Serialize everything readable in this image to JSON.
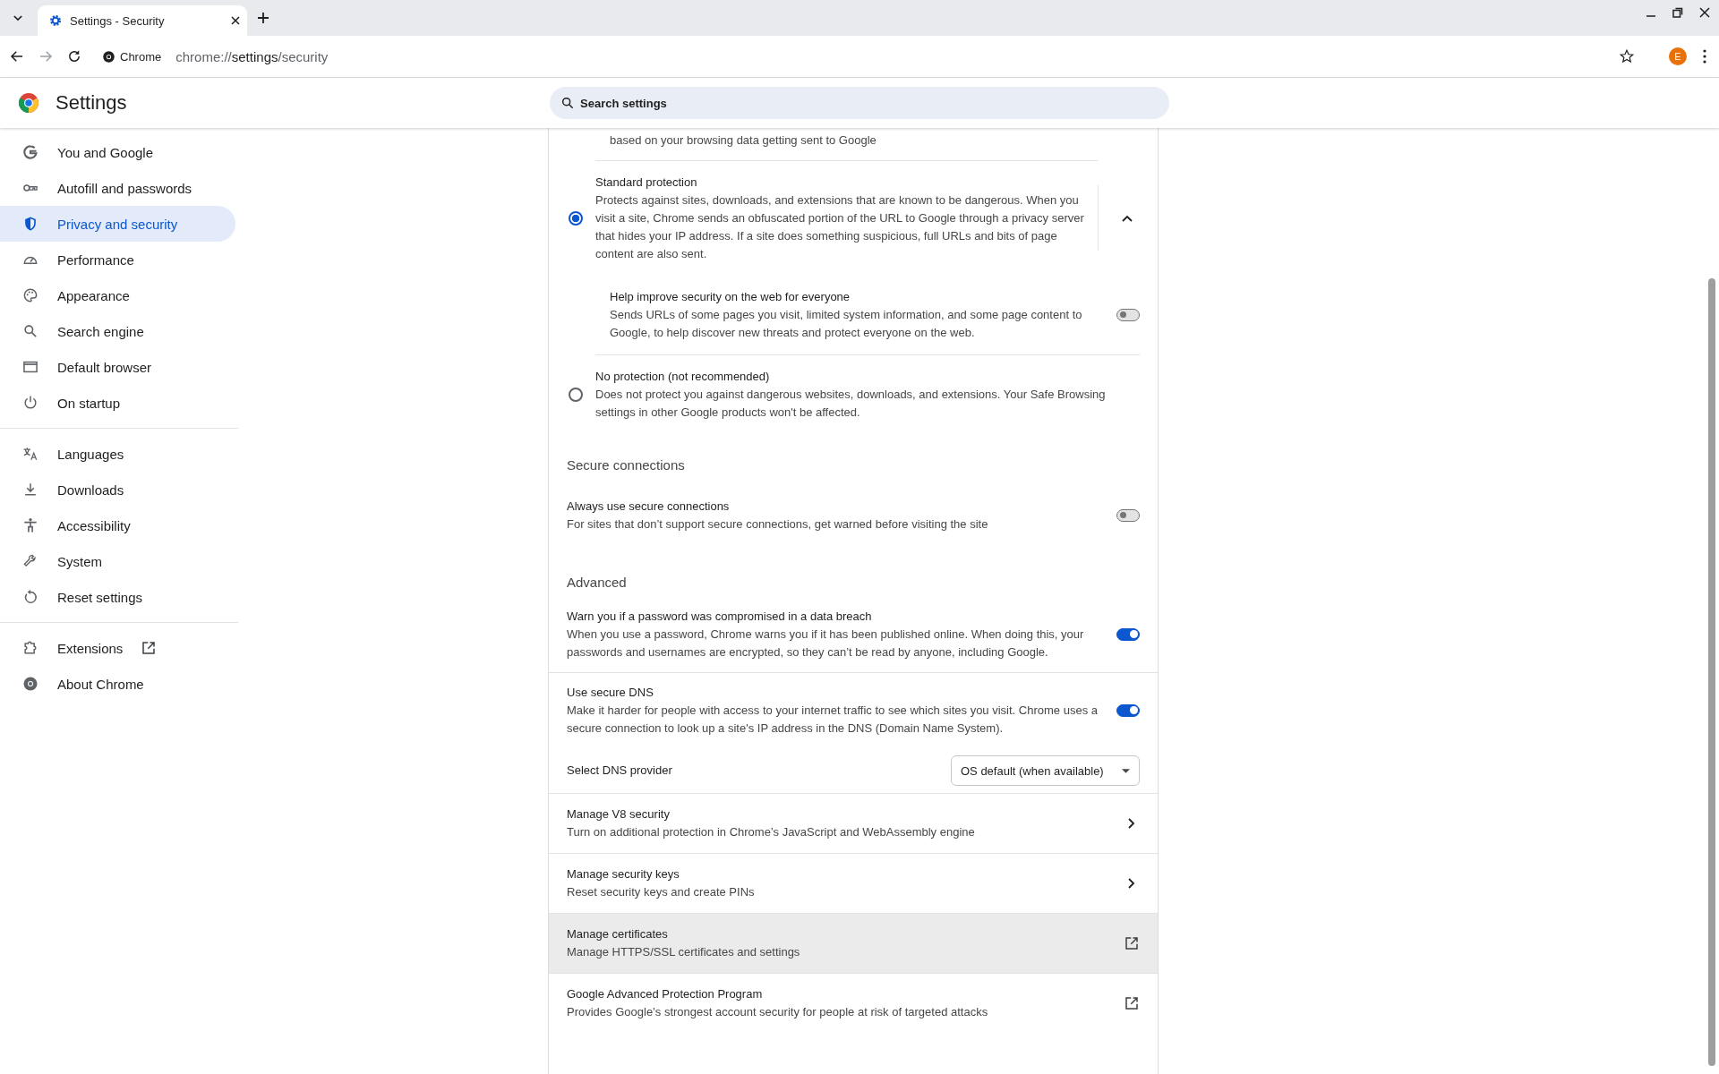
{
  "browser": {
    "tabs": [
      {
        "title": "Settings - Security",
        "selected": true
      }
    ],
    "site_chip": "Chrome",
    "url_prefix": "chrome://",
    "url_path": "settings/security",
    "avatar": "E"
  },
  "header": {
    "title": "Settings",
    "search": {
      "placeholder": "Search settings"
    }
  },
  "sidebar": {
    "groups": [
      {
        "items": [
          {
            "label": "You and Google",
            "kind": "page",
            "selected": false
          },
          {
            "label": "Autofill and passwords",
            "kind": "page",
            "selected": false
          },
          {
            "label": "Privacy and security",
            "kind": "page",
            "selected": true
          },
          {
            "label": "Performance",
            "kind": "page",
            "selected": false
          },
          {
            "label": "Appearance",
            "kind": "page",
            "selected": false
          },
          {
            "label": "Search engine",
            "kind": "page",
            "selected": false
          },
          {
            "label": "Default browser",
            "kind": "page",
            "selected": false
          },
          {
            "label": "On startup",
            "kind": "page",
            "selected": false
          }
        ]
      },
      {
        "items": [
          {
            "label": "Languages",
            "kind": "page",
            "selected": false
          },
          {
            "label": "Downloads",
            "kind": "page",
            "selected": false
          },
          {
            "label": "Accessibility",
            "kind": "page",
            "selected": false
          },
          {
            "label": "System",
            "kind": "page",
            "selected": false
          },
          {
            "label": "Reset settings",
            "kind": "page",
            "selected": false
          }
        ]
      },
      {
        "items": [
          {
            "label": "Extensions",
            "kind": "external",
            "selected": false
          },
          {
            "label": "About Chrome",
            "kind": "page",
            "selected": false
          }
        ]
      }
    ]
  },
  "content": {
    "blocks": [
      {
        "kind": "cut_text",
        "description": "based on your browsing data getting sent to Google"
      },
      {
        "kind": "radio",
        "title": "Standard protection",
        "description": "Protects against sites, downloads, and extensions that are known to be dangerous. When you visit a site, Chrome sends an obfuscated portion of the URL to Google through a privacy server that hides your IP address. If a site does something suspicious, full URLs and bits of page content are also sent.",
        "selected": true,
        "expanded": true
      },
      {
        "kind": "subtoggle",
        "title": "Help improve security on the web for everyone",
        "description": "Sends URLs of some pages you visit, limited system information, and some page content to Google, to help discover new threats and protect everyone on the web.",
        "on": false
      },
      {
        "kind": "radio",
        "title": "No protection (not recommended)",
        "description": "Does not protect you against dangerous websites, downloads, and extensions. Your Safe Browsing settings in other Google products won't be affected.",
        "selected": false
      },
      {
        "kind": "heading",
        "title": "Secure connections"
      },
      {
        "kind": "toggle",
        "title": "Always use secure connections",
        "description": "For sites that don’t support secure connections, get warned before visiting the site",
        "on": false
      },
      {
        "kind": "heading",
        "title": "Advanced"
      },
      {
        "kind": "toggle",
        "title": "Warn you if a password was compromised in a data breach",
        "description": "When you use a password, Chrome warns you if it has been published online. When doing this, your passwords and usernames are encrypted, so they can’t be read by anyone, including Google.",
        "on": true
      },
      {
        "kind": "toggle",
        "title": "Use secure DNS",
        "description": "Make it harder for people with access to your internet traffic to see which sites you visit. Chrome uses a secure connection to look up a site's IP address in the DNS (Domain Name System).",
        "on": true
      },
      {
        "kind": "select",
        "title": "Select DNS provider",
        "value": "OS default (when available)"
      },
      {
        "kind": "subpage_link",
        "title": "Manage V8 security",
        "description": "Turn on additional protection in Chrome’s JavaScript and WebAssembly engine",
        "hovered": false
      },
      {
        "kind": "subpage_link",
        "title": "Manage security keys",
        "description": "Reset security keys and create PINs",
        "hovered": false
      },
      {
        "kind": "external_link",
        "title": "Manage certificates",
        "description": "Manage HTTPS/SSL certificates and settings",
        "hovered": true
      },
      {
        "kind": "external_link",
        "title": "Google Advanced Protection Program",
        "description": "Provides Google’s strongest account security for people at risk of targeted attacks",
        "hovered": false
      }
    ]
  }
}
